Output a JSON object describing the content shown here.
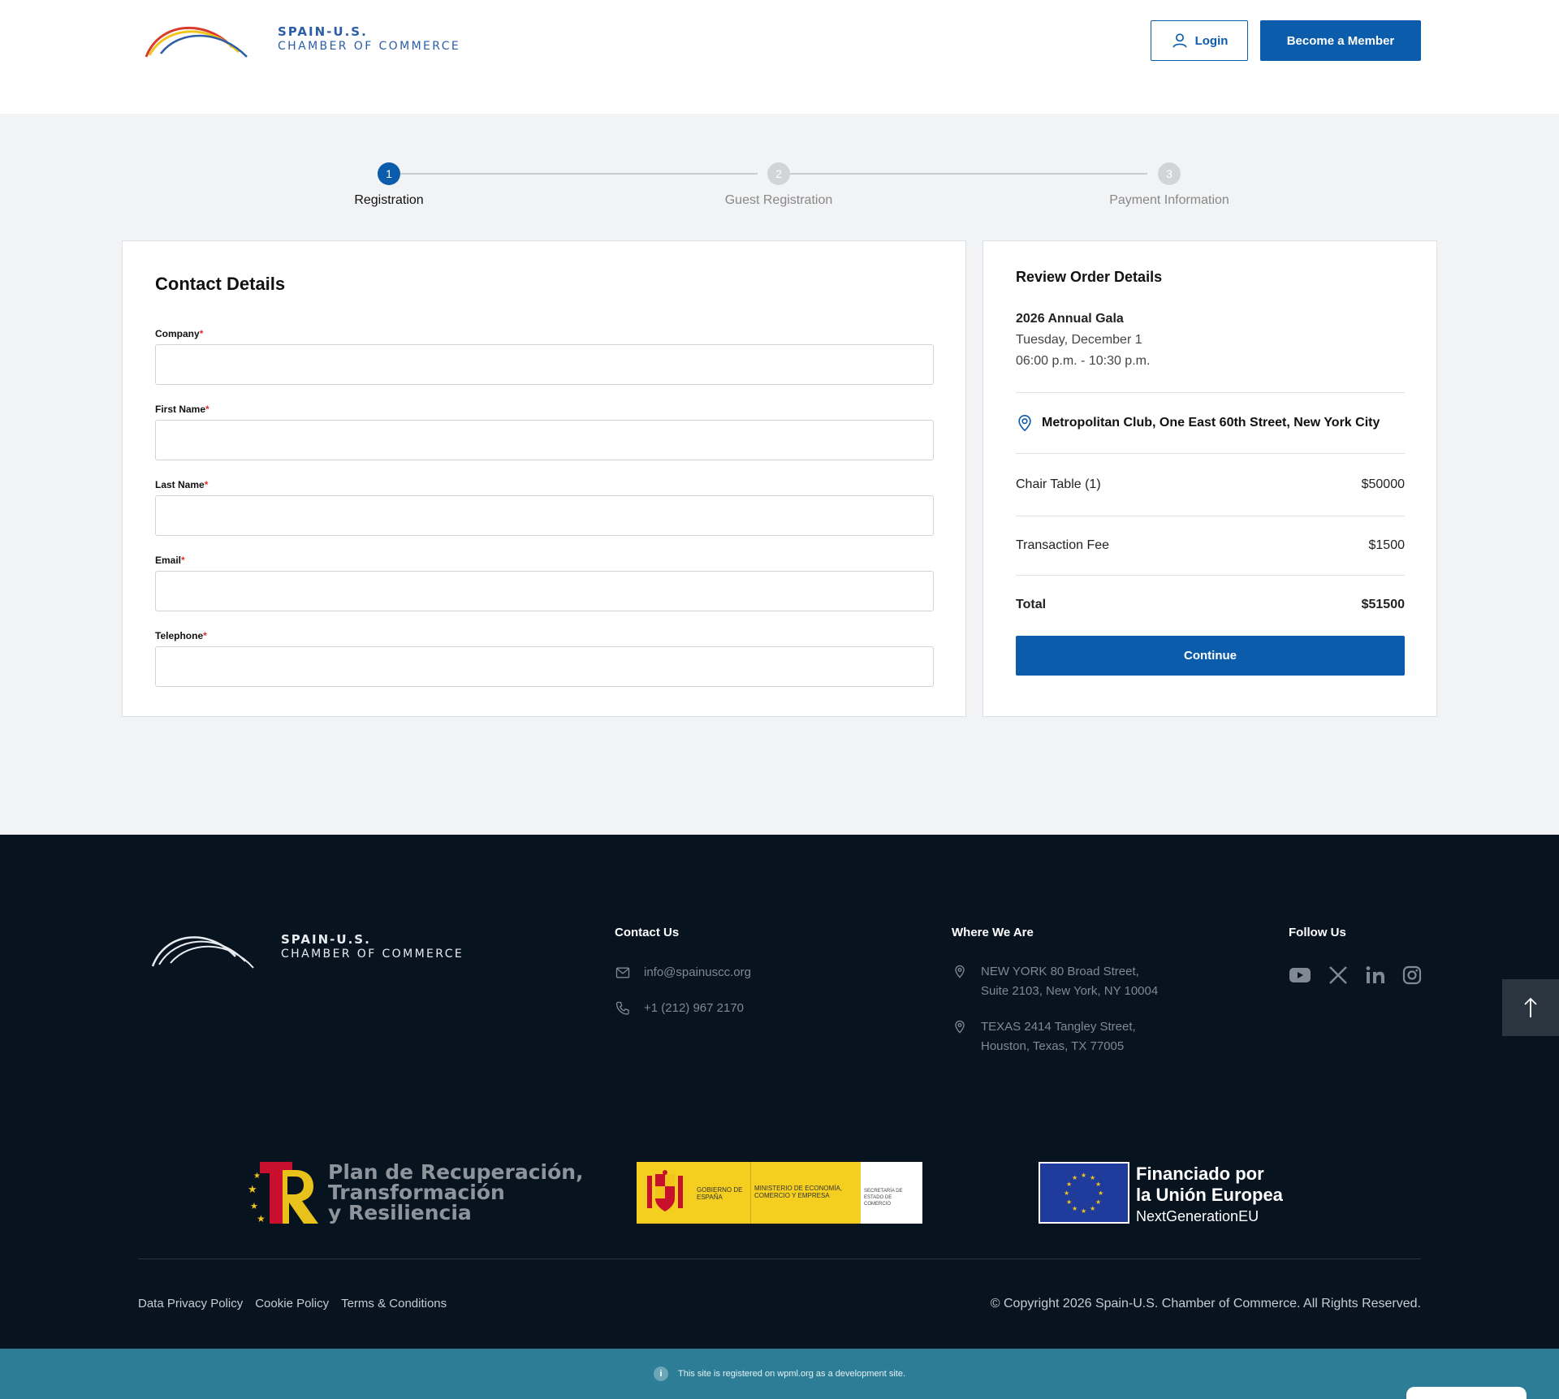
{
  "brand": {
    "line1": "SPAIN-U.S.",
    "line2": "CHAMBER OF COMMERCE",
    "colors": {
      "primary": "#0b5cab",
      "footer_bg": "#07131f",
      "banner_bg": "#2e7d96"
    }
  },
  "header": {
    "login_label": "Login",
    "member_label": "Become a Member"
  },
  "stepper": {
    "steps": [
      {
        "number": "1",
        "label": "Registration",
        "state": "active"
      },
      {
        "number": "2",
        "label": "Guest Registration",
        "state": "inactive"
      },
      {
        "number": "3",
        "label": "Payment Information",
        "state": "inactive"
      }
    ]
  },
  "contact": {
    "title": "Contact Details",
    "required_mark": "*",
    "fields": [
      {
        "label": "Company",
        "value": ""
      },
      {
        "label": "First Name",
        "value": ""
      },
      {
        "label": "Last Name",
        "value": ""
      },
      {
        "label": "Email",
        "value": ""
      },
      {
        "label": "Telephone",
        "value": ""
      }
    ]
  },
  "review": {
    "title": "Review Order Details",
    "event_name": "2026 Annual Gala",
    "event_date": "Tuesday, December 1",
    "event_time": "06:00 p.m. - 10:30 p.m.",
    "venue": "Metropolitan Club, One East 60th Street, New York City",
    "lines": [
      {
        "label": "Chair Table (1)",
        "amount": "$50000"
      },
      {
        "label": "Transaction Fee",
        "amount": "$1500"
      }
    ],
    "total_label": "Total",
    "total_amount": "$51500",
    "continue_label": "Continue"
  },
  "footer": {
    "contact_heading": "Contact Us",
    "email": "info@spainuscc.org",
    "phone": "+1 (212) 967 2170",
    "where_heading": "Where We Are",
    "ny_line1": "NEW YORK 80 Broad Street,",
    "ny_line2": "Suite 2103, New York, NY 10004",
    "tx_line1": "TEXAS 2414 Tangley Street,",
    "tx_line2": "Houston, Texas, TX 77005",
    "follow_heading": "Follow Us",
    "social_icons": [
      "youtube-icon",
      "x-icon",
      "linkedin-icon",
      "instagram-icon"
    ],
    "sponsor1_line1": "Plan de Recuperación,",
    "sponsor1_line2": "Transformación",
    "sponsor1_line3": "y Resiliencia",
    "sponsor2_gob": "GOBIERNO DE ESPAÑA",
    "sponsor2_min": "MINISTERIO DE ECONOMÍA, COMERCIO Y EMPRESA",
    "sponsor2_sec": "SECRETARÍA DE ESTADO DE COMERCIO",
    "sponsor3_line1": "Financiado por",
    "sponsor3_line2": "la Unión Europea",
    "sponsor3_line3": "NextGenerationEU",
    "links": [
      "Data Privacy Policy",
      "Cookie Policy",
      "Terms & Conditions"
    ],
    "copyright": "© Copyright 2026 Spain-U.S. Chamber of Commerce. All Rights Reserved."
  },
  "wpml_notice": "This site is registered on wpml.org as a development site."
}
